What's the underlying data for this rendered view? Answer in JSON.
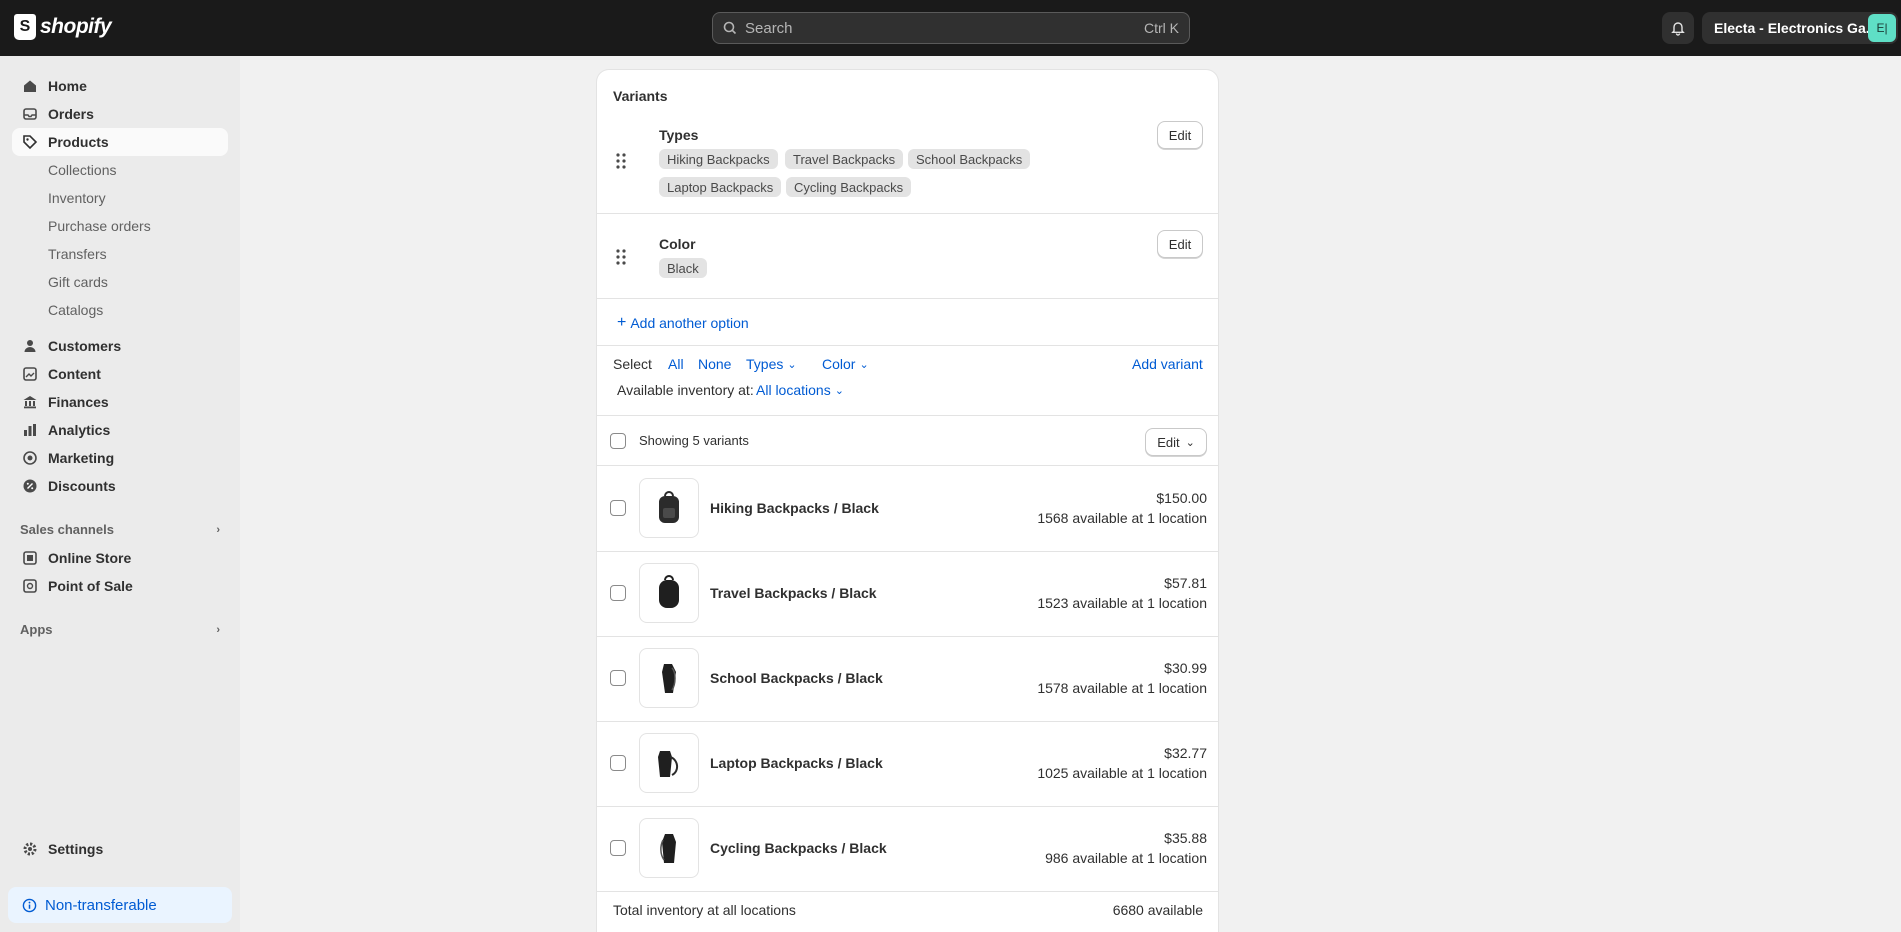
{
  "topbar": {
    "logo_text": "shopify",
    "search_placeholder": "Search",
    "search_shortcut": "Ctrl K",
    "store_name": "Electa - Electronics Ga...",
    "avatar_initials": "E|"
  },
  "sidebar": {
    "main": [
      {
        "label": "Home",
        "icon": "home-icon"
      },
      {
        "label": "Orders",
        "icon": "orders-icon"
      },
      {
        "label": "Products",
        "icon": "tag-icon"
      }
    ],
    "product_sub": [
      "Collections",
      "Inventory",
      "Purchase orders",
      "Transfers",
      "Gift cards",
      "Catalogs"
    ],
    "more": [
      {
        "label": "Customers",
        "icon": "person-icon"
      },
      {
        "label": "Content",
        "icon": "content-icon"
      },
      {
        "label": "Finances",
        "icon": "bank-icon"
      },
      {
        "label": "Analytics",
        "icon": "chart-icon"
      },
      {
        "label": "Marketing",
        "icon": "target-icon"
      },
      {
        "label": "Discounts",
        "icon": "discount-icon"
      }
    ],
    "sales_channels_title": "Sales channels",
    "channels": [
      {
        "label": "Online Store",
        "icon": "store-icon"
      },
      {
        "label": "Point of Sale",
        "icon": "pos-icon"
      }
    ],
    "apps_title": "Apps",
    "settings_label": "Settings",
    "nontransferable_label": "Non-transferable"
  },
  "variants_card": {
    "title": "Variants",
    "options": [
      {
        "name": "Types",
        "values": [
          "Hiking Backpacks",
          "Travel Backpacks",
          "School Backpacks",
          "Laptop Backpacks",
          "Cycling Backpacks"
        ],
        "edit_label": "Edit"
      },
      {
        "name": "Color",
        "values": [
          "Black"
        ],
        "edit_label": "Edit"
      }
    ],
    "add_option_label": "Add another option",
    "select_label": "Select",
    "select_all": "All",
    "select_none": "None",
    "filter_types": "Types",
    "filter_color": "Color",
    "add_variant_label": "Add variant",
    "available_at_label": "Available inventory at:",
    "locations_label": "All locations",
    "showing_label": "Showing 5 variants",
    "bulk_edit_label": "Edit",
    "variants": [
      {
        "name": "Hiking Backpacks / Black",
        "price": "$150.00",
        "availability": "1568 available at 1 location"
      },
      {
        "name": "Travel Backpacks / Black",
        "price": "$57.81",
        "availability": "1523 available at 1 location"
      },
      {
        "name": "School Backpacks / Black",
        "price": "$30.99",
        "availability": "1578 available at 1 location"
      },
      {
        "name": "Laptop Backpacks / Black",
        "price": "$32.77",
        "availability": "1025 available at 1 location"
      },
      {
        "name": "Cycling Backpacks / Black",
        "price": "$35.88",
        "availability": "986 available at 1 location"
      }
    ],
    "total_label": "Total inventory at all locations",
    "total_value": "6680 available"
  },
  "colors": {
    "topbar": "#1a1a1a",
    "accent_link": "#005bd3",
    "avatar": "#5fdfc6"
  }
}
